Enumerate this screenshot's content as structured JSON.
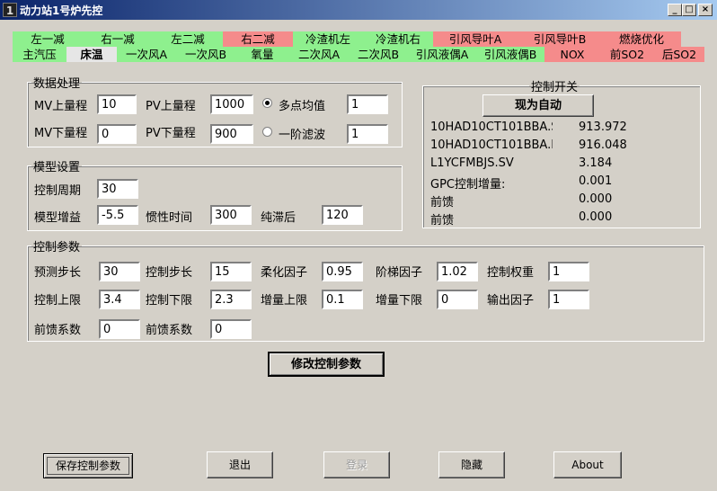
{
  "window": {
    "title": "动力站1号炉先控",
    "icon_char": "1",
    "minimize": "_",
    "maximize": "□",
    "close": "×"
  },
  "tabs_row1": [
    {
      "label": "左一减",
      "color": "green"
    },
    {
      "label": "右一减",
      "color": "green"
    },
    {
      "label": "左二减",
      "color": "green"
    },
    {
      "label": "右二减",
      "color": "red"
    },
    {
      "label": "冷渣机左",
      "color": "green"
    },
    {
      "label": "冷渣机右",
      "color": "green"
    },
    {
      "label": "引风导叶A",
      "color": "red"
    },
    {
      "label": "引风导叶B",
      "color": "red"
    },
    {
      "label": "燃烧优化",
      "color": "red"
    }
  ],
  "tabs_row2": [
    {
      "label": "主汽压",
      "color": "green"
    },
    {
      "label": "床温",
      "color": "active"
    },
    {
      "label": "一次风A",
      "color": "green"
    },
    {
      "label": "一次风B",
      "color": "green"
    },
    {
      "label": "氧量",
      "color": "green"
    },
    {
      "label": "二次风A",
      "color": "green"
    },
    {
      "label": "二次风B",
      "color": "green"
    },
    {
      "label": "引风液偶A",
      "color": "green"
    },
    {
      "label": "引风液偶B",
      "color": "green"
    },
    {
      "label": "NOX",
      "color": "red"
    },
    {
      "label": "前SO2",
      "color": "red"
    },
    {
      "label": "后SO2",
      "color": "red"
    }
  ],
  "data_proc": {
    "legend": "数据处理",
    "mv_upper_label": "MV上量程",
    "mv_upper": "10",
    "mv_lower_label": "MV下量程",
    "mv_lower": "0",
    "pv_upper_label": "PV上量程",
    "pv_upper": "1000",
    "pv_lower_label": "PV下量程",
    "pv_lower": "900",
    "radio_multi_label": "多点均值",
    "radio_multi_value": "1",
    "radio_filter_label": "一阶滤波",
    "radio_filter_value": "1"
  },
  "model": {
    "legend": "模型设置",
    "period_label": "控制周期",
    "period": "30",
    "gain_label": "模型增益",
    "gain": "-5.5",
    "inertia_label": "惯性时间",
    "inertia": "300",
    "delay_label": "纯滞后",
    "delay": "120"
  },
  "control_switch": {
    "legend": "控制开关",
    "button_label": "现为自动",
    "rows": [
      {
        "name": "10HAD10CT101BBA.S",
        "value": "913.972"
      },
      {
        "name": "10HAD10CT101BBA.I",
        "value": "916.048"
      },
      {
        "name": "L1YCFMBJS.SV",
        "value": "3.184"
      },
      {
        "name": "GPC控制增量:",
        "value": "0.001"
      },
      {
        "name": "前馈",
        "value": "0.000"
      },
      {
        "name": "前馈",
        "value": "0.000"
      }
    ]
  },
  "params": {
    "legend": "控制参数",
    "pred_step_label": "预测步长",
    "pred_step": "30",
    "ctrl_step_label": "控制步长",
    "ctrl_step": "15",
    "soft_label": "柔化因子",
    "soft": "0.95",
    "stair_label": "阶梯因子",
    "stair": "1.02",
    "weight_label": "控制权重",
    "weight": "1",
    "upper_label": "控制上限",
    "upper": "3.4",
    "lower_label": "控制下限",
    "lower": "2.3",
    "inc_upper_label": "增量上限",
    "inc_upper": "0.1",
    "inc_lower_label": "增量下限",
    "inc_lower": "0",
    "out_label": "输出因子",
    "out": "1",
    "ff1_label": "前馈系数",
    "ff1": "0",
    "ff2_label": "前馈系数",
    "ff2": "0"
  },
  "buttons": {
    "modify": "修改控制参数",
    "save": "保存控制参数",
    "exit": "退出",
    "login": "登录",
    "hide": "隐藏",
    "about": "About"
  }
}
